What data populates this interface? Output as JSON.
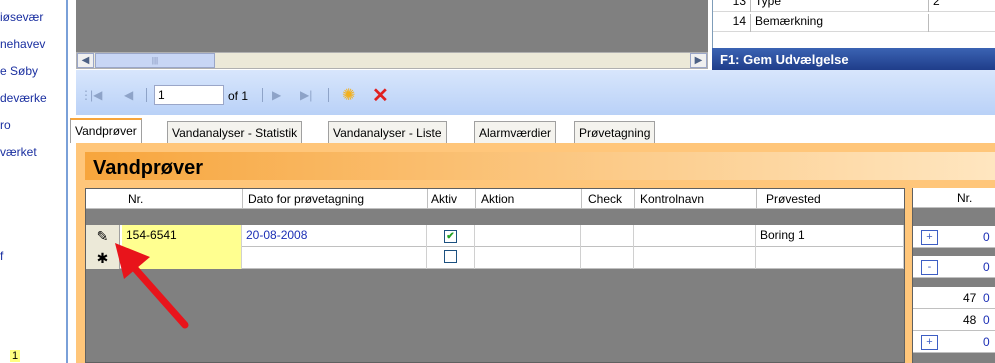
{
  "sidebar": {
    "items": [
      "iøsevær",
      "nehavev",
      "e Søby",
      "deværke",
      "ro",
      "værket",
      "f"
    ],
    "badge": "1"
  },
  "right_panel": {
    "rows": [
      {
        "num": "13",
        "label": "Type",
        "value": "2"
      },
      {
        "num": "14",
        "label": "Bemærkning",
        "value": ""
      }
    ],
    "header": "F1: Gem Udvælgelse"
  },
  "navigator": {
    "position": "1",
    "of_label": "of 1"
  },
  "tabs": [
    "Vandprøver",
    "Vandanalyser - Statistik",
    "Vandanalyser - Liste",
    "Alarmværdier",
    "Prøvetagning"
  ],
  "content": {
    "title": "Vandprøver",
    "grid": {
      "columns": [
        "Nr.",
        "Dato for prøvetagning",
        "Aktiv",
        "Aktion",
        "Check",
        "Kontrolnavn",
        "Prøvested"
      ],
      "rows": [
        {
          "selector": "✎",
          "nr": "154-6541",
          "date": "20-08-2008",
          "aktiv": true,
          "aktion": "",
          "check": "",
          "kontrolnavn": "",
          "provested": "Boring 1"
        },
        {
          "selector": "✱",
          "nr": "",
          "date": "",
          "aktiv": false,
          "aktion": "",
          "check": "",
          "kontrolnavn": "",
          "provested": ""
        }
      ]
    },
    "right_grid": {
      "header": "Nr.",
      "rows": [
        {
          "btn": "+",
          "num": "",
          "val": "0"
        },
        {
          "btn": "-",
          "num": "",
          "val": "0"
        },
        {
          "btn": "",
          "num": "47",
          "val": "0"
        },
        {
          "btn": "",
          "num": "48",
          "val": "0"
        },
        {
          "btn": "+",
          "num": "",
          "val": "0"
        }
      ]
    }
  },
  "colors": {
    "accent_orange": "#f7a53c",
    "arrow_red": "#e8141b",
    "link_blue": "#1c2fb5"
  }
}
